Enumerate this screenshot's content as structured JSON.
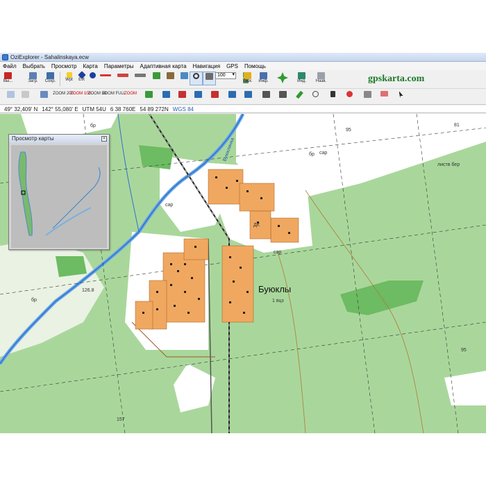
{
  "window": {
    "title": "OziExplorer - Sahalinskaya.ecw"
  },
  "menu": [
    "Файл",
    "Выбрать",
    "Просмотр",
    "Карта",
    "Параметры",
    "Адаптивная карта",
    "Навигация",
    "GPS",
    "Помощь"
  ],
  "toolbar1": {
    "exit_label": "Вы...",
    "load_label": "Загр.",
    "save_label": "Сохр.",
    "wpt_label": "Wpt",
    "evt_label": "Evt",
    "zoom_value": "100",
    "task_label": "Таск.",
    "info_label": "Инф.",
    "ind_label": "Инд.",
    "name_label": "Назв."
  },
  "toolbar2": {
    "zoom200": "ZOOM 200",
    "zoom100": "ZOOM 100",
    "zoom50": "ZOOM 50",
    "zoomfull": "ZOOM FULL",
    "zoomx": "ZOOM"
  },
  "brand": "gpskarta.com",
  "status": {
    "lat": "49° 32,409' N",
    "lon": "142° 55,080' E",
    "utm": "UTM  54U",
    "easting": "6 38 760E",
    "northing": "54 89 272N",
    "datum": "WGS 84"
  },
  "overview": {
    "title": "Просмотр карты"
  },
  "map": {
    "village": "Буюклы",
    "village_sub": "1 вцз",
    "labels": [
      "бр",
      "бр",
      "бр",
      "95",
      "95",
      "81",
      "157",
      "126.8",
      "сар",
      "сар",
      "листв бер",
      "Буюклинка",
      "ДК",
      "бр",
      "сар"
    ]
  }
}
